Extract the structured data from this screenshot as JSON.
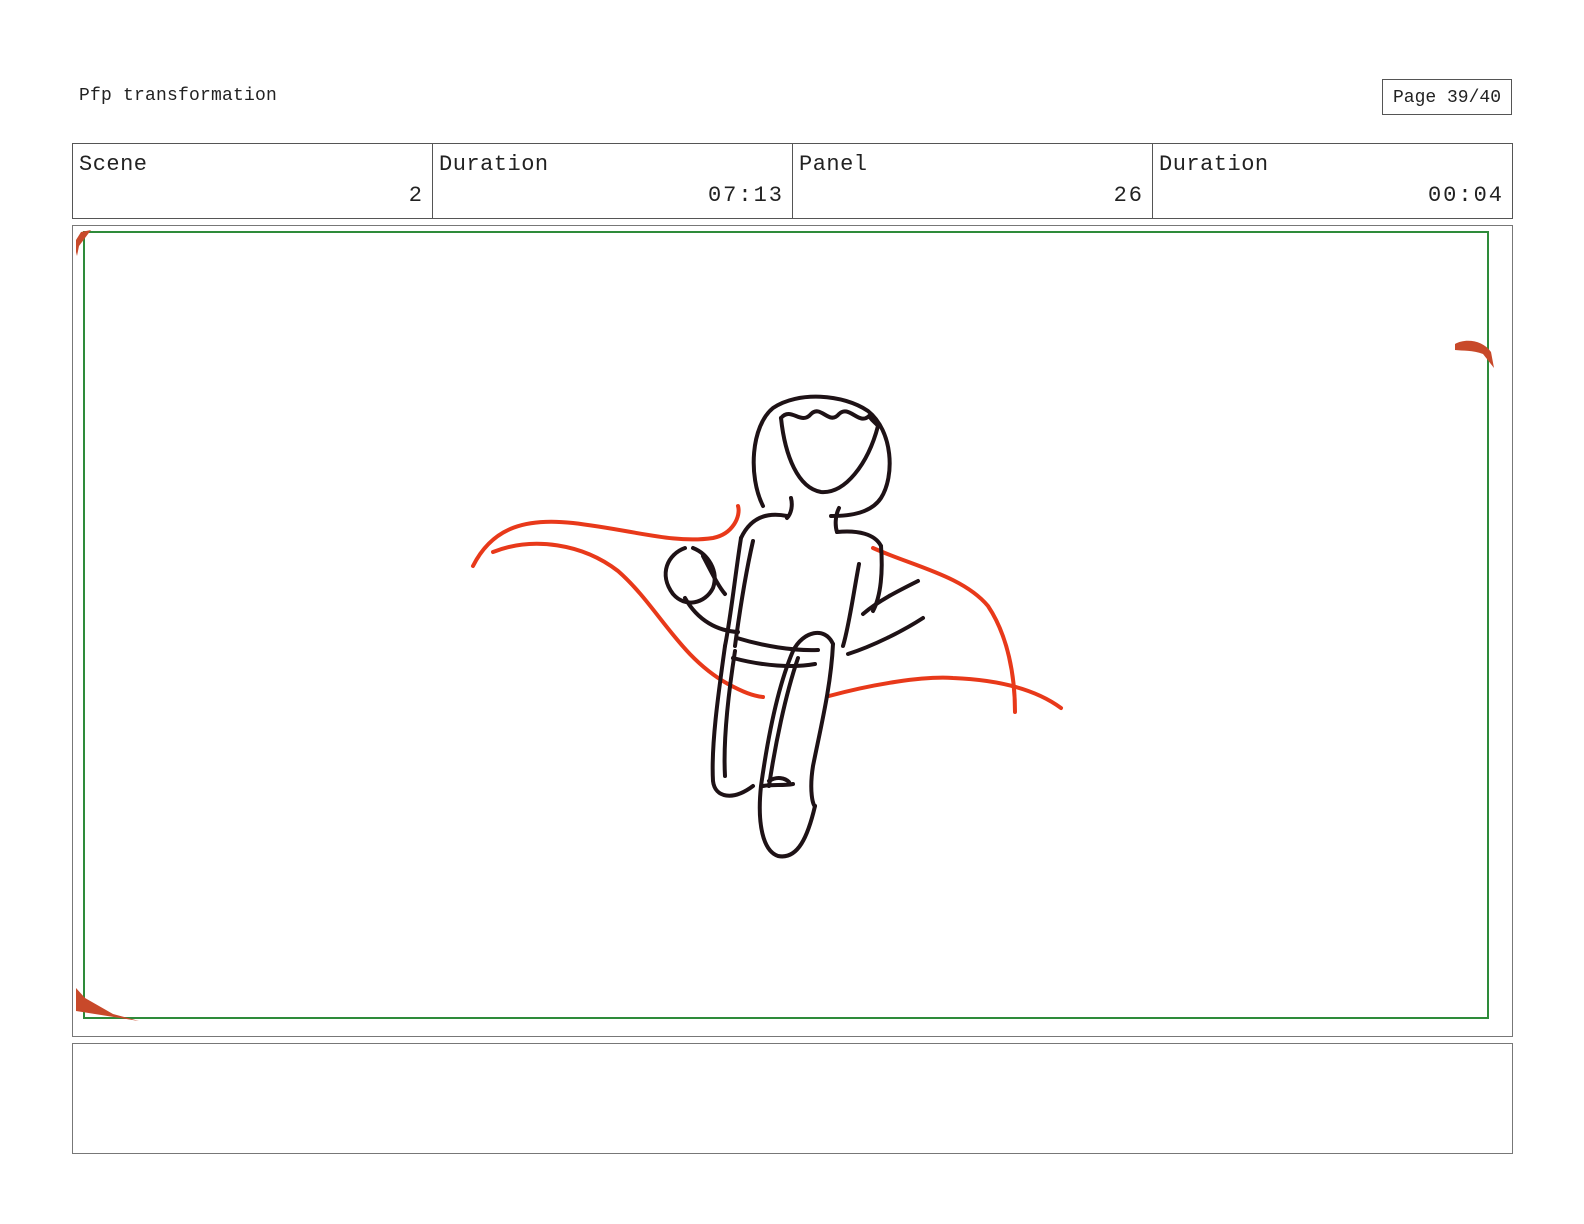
{
  "header": {
    "title": "Pfp transformation",
    "page": "Page 39/40"
  },
  "info": {
    "scene_label": "Scene",
    "scene_value": "2",
    "scene_duration_label": "Duration",
    "scene_duration_value": "07:13",
    "panel_label": "Panel",
    "panel_value": "26",
    "panel_duration_label": "Duration",
    "panel_duration_value": "00:04"
  },
  "colors": {
    "safe_frame": "#2e8b3a",
    "sketch_line": "#1e1216",
    "cape": "#e8391a",
    "corner_marks": "#c8492a"
  },
  "notes": ""
}
